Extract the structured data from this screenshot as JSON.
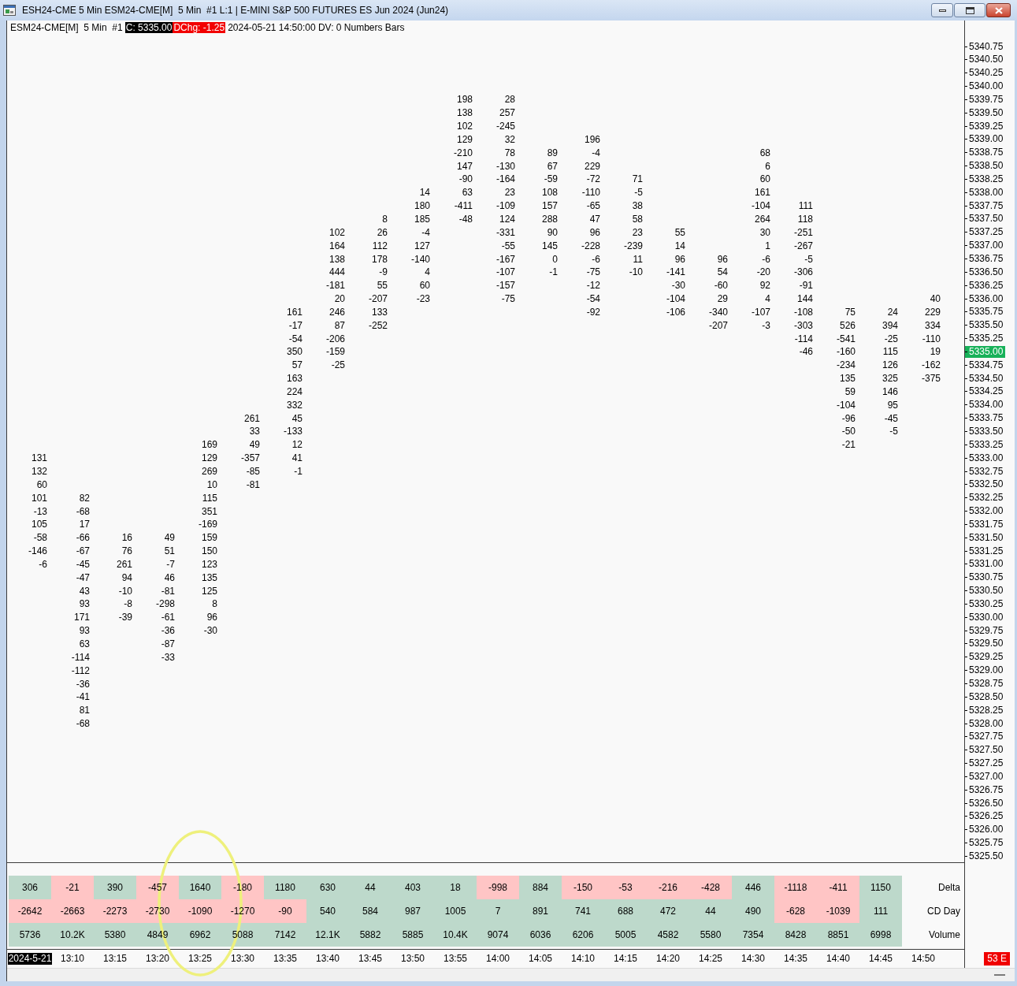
{
  "window": {
    "title": "ESH24-CME 5 Min ESM24-CME[M]  5 Min  #1 L:1 | E-MINI S&P 500 FUTURES ES Jun 2024 (Jun24)"
  },
  "header": [
    {
      "kind": "plain",
      "text": "ESM24-CME[M]  5 Min  #1"
    },
    {
      "kind": "close",
      "text": "C: 5335.00"
    },
    {
      "kind": "change",
      "text": "DChg: -1.25"
    },
    {
      "kind": "plain",
      "text": "2024-05-21 14:50:00 DV: 0 Numbers Bars"
    }
  ],
  "price_axis": [
    {
      "text": "5340.75",
      "selected": false
    },
    {
      "text": "5340.50",
      "selected": false
    },
    {
      "text": "5340.25",
      "selected": false
    },
    {
      "text": "5340.00",
      "selected": false
    },
    {
      "text": "5339.75",
      "selected": false
    },
    {
      "text": "5339.50",
      "selected": false
    },
    {
      "text": "5339.25",
      "selected": false
    },
    {
      "text": "5339.00",
      "selected": false
    },
    {
      "text": "5338.75",
      "selected": false
    },
    {
      "text": "5338.50",
      "selected": false
    },
    {
      "text": "5338.25",
      "selected": false
    },
    {
      "text": "5338.00",
      "selected": false
    },
    {
      "text": "5337.75",
      "selected": false
    },
    {
      "text": "5337.50",
      "selected": false
    },
    {
      "text": "5337.25",
      "selected": false
    },
    {
      "text": "5337.00",
      "selected": false
    },
    {
      "text": "5336.75",
      "selected": false
    },
    {
      "text": "5336.50",
      "selected": false
    },
    {
      "text": "5336.25",
      "selected": false
    },
    {
      "text": "5336.00",
      "selected": false
    },
    {
      "text": "5335.75",
      "selected": false
    },
    {
      "text": "5335.50",
      "selected": false
    },
    {
      "text": "5335.25",
      "selected": false
    },
    {
      "text": "5335.00",
      "selected": true
    },
    {
      "text": "5334.75",
      "selected": false
    },
    {
      "text": "5334.50",
      "selected": false
    },
    {
      "text": "5334.25",
      "selected": false
    },
    {
      "text": "5334.00",
      "selected": false
    },
    {
      "text": "5333.75",
      "selected": false
    },
    {
      "text": "5333.50",
      "selected": false
    },
    {
      "text": "5333.25",
      "selected": false
    },
    {
      "text": "5333.00",
      "selected": false
    },
    {
      "text": "5332.75",
      "selected": false
    },
    {
      "text": "5332.50",
      "selected": false
    },
    {
      "text": "5332.25",
      "selected": false
    },
    {
      "text": "5332.00",
      "selected": false
    },
    {
      "text": "5331.75",
      "selected": false
    },
    {
      "text": "5331.50",
      "selected": false
    },
    {
      "text": "5331.25",
      "selected": false
    },
    {
      "text": "5331.00",
      "selected": false
    },
    {
      "text": "5330.75",
      "selected": false
    },
    {
      "text": "5330.50",
      "selected": false
    },
    {
      "text": "5330.25",
      "selected": false
    },
    {
      "text": "5330.00",
      "selected": false
    },
    {
      "text": "5329.75",
      "selected": false
    },
    {
      "text": "5329.50",
      "selected": false
    },
    {
      "text": "5329.25",
      "selected": false
    },
    {
      "text": "5329.00",
      "selected": false
    },
    {
      "text": "5328.75",
      "selected": false
    },
    {
      "text": "5328.50",
      "selected": false
    },
    {
      "text": "5328.25",
      "selected": false
    },
    {
      "text": "5328.00",
      "selected": false
    },
    {
      "text": "5327.75",
      "selected": false
    },
    {
      "text": "5327.50",
      "selected": false
    },
    {
      "text": "5327.25",
      "selected": false
    },
    {
      "text": "5327.00",
      "selected": false
    },
    {
      "text": "5326.75",
      "selected": false
    },
    {
      "text": "5326.50",
      "selected": false
    },
    {
      "text": "5326.25",
      "selected": false
    },
    {
      "text": "5326.00",
      "selected": false
    },
    {
      "text": "5325.75",
      "selected": false
    },
    {
      "text": "5325.50",
      "selected": false
    }
  ],
  "bars": [
    {
      "cells": [
        null,
        null,
        null,
        null,
        null,
        null,
        null,
        null,
        null,
        null,
        null,
        null,
        null,
        null,
        null,
        null,
        null,
        null,
        null,
        null,
        null,
        null,
        null,
        null,
        null,
        null,
        null,
        null,
        null,
        null,
        null,
        "131",
        "132",
        "60",
        "101",
        "-13",
        "105",
        "-58",
        "-146",
        "-6"
      ]
    },
    {
      "cells": [
        null,
        null,
        null,
        null,
        null,
        null,
        null,
        null,
        null,
        null,
        null,
        null,
        null,
        null,
        null,
        null,
        null,
        null,
        null,
        null,
        null,
        null,
        null,
        null,
        null,
        null,
        null,
        null,
        null,
        null,
        null,
        null,
        null,
        null,
        "82",
        "-68",
        "17",
        "-66",
        "-67",
        "-45",
        "-47",
        "43",
        "93",
        "171",
        "93",
        "63",
        "-114",
        "-112",
        "-36",
        "-41",
        "81",
        "-68"
      ]
    },
    {
      "cells": [
        null,
        null,
        null,
        null,
        null,
        null,
        null,
        null,
        null,
        null,
        null,
        null,
        null,
        null,
        null,
        null,
        null,
        null,
        null,
        null,
        null,
        null,
        null,
        null,
        null,
        null,
        null,
        null,
        null,
        null,
        null,
        null,
        null,
        null,
        null,
        null,
        null,
        "16",
        "76",
        "261",
        "94",
        "-10",
        "-8",
        "-39"
      ]
    },
    {
      "cells": [
        null,
        null,
        null,
        null,
        null,
        null,
        null,
        null,
        null,
        null,
        null,
        null,
        null,
        null,
        null,
        null,
        null,
        null,
        null,
        null,
        null,
        null,
        null,
        null,
        null,
        null,
        null,
        null,
        null,
        null,
        null,
        null,
        null,
        null,
        null,
        null,
        null,
        "49",
        "51",
        "-7",
        "46",
        "-81",
        "-298",
        "-61",
        "-36",
        "-87",
        "-33"
      ]
    },
    {
      "cells": [
        null,
        null,
        null,
        null,
        null,
        null,
        null,
        null,
        null,
        null,
        null,
        null,
        null,
        null,
        null,
        null,
        null,
        null,
        null,
        null,
        null,
        null,
        null,
        null,
        null,
        null,
        null,
        null,
        null,
        null,
        "169",
        "129",
        "269",
        "10",
        "115",
        "351",
        "-169",
        "159",
        "150",
        "123",
        "135",
        "125",
        "8",
        "96",
        "-30"
      ]
    },
    {
      "cells": [
        null,
        null,
        null,
        null,
        null,
        null,
        null,
        null,
        null,
        null,
        null,
        null,
        null,
        null,
        null,
        null,
        null,
        null,
        null,
        null,
        null,
        null,
        null,
        null,
        null,
        null,
        null,
        null,
        "261",
        "33",
        "49",
        "-357",
        "-85",
        "-81"
      ]
    },
    {
      "cells": [
        null,
        null,
        null,
        null,
        null,
        null,
        null,
        null,
        null,
        null,
        null,
        null,
        null,
        null,
        null,
        null,
        null,
        null,
        null,
        null,
        "161",
        "-17",
        "-54",
        "350",
        "57",
        "163",
        "224",
        "332",
        "45",
        "-133",
        "12",
        "41",
        "-1"
      ]
    },
    {
      "cells": [
        null,
        null,
        null,
        null,
        null,
        null,
        null,
        null,
        null,
        null,
        null,
        null,
        null,
        null,
        "102",
        "164",
        "138",
        "444",
        "-181",
        "20",
        "246",
        "87",
        "-206",
        "-159",
        "-25"
      ]
    },
    {
      "cells": [
        null,
        null,
        null,
        null,
        null,
        null,
        null,
        null,
        null,
        null,
        null,
        null,
        null,
        "8",
        "26",
        "112",
        "178",
        "-9",
        "55",
        "-207",
        "133",
        "-252"
      ]
    },
    {
      "cells": [
        null,
        null,
        null,
        null,
        null,
        null,
        null,
        null,
        null,
        null,
        null,
        "14",
        "180",
        "185",
        "-4",
        "127",
        "-140",
        "4",
        "60",
        "-23"
      ]
    },
    {
      "cells": [
        null,
        null,
        null,
        null,
        "198",
        "138",
        "102",
        "129",
        "-210",
        "147",
        "-90",
        "63",
        "-411",
        "-48"
      ]
    },
    {
      "cells": [
        null,
        null,
        null,
        null,
        "28",
        "257",
        "-245",
        "32",
        "78",
        "-130",
        "-164",
        "23",
        "-109",
        "124",
        "-331",
        "-55",
        "-167",
        "-107",
        "-157",
        "-75"
      ]
    },
    {
      "cells": [
        null,
        null,
        null,
        null,
        null,
        null,
        null,
        null,
        "89",
        "67",
        "-59",
        "108",
        "157",
        "288",
        "90",
        "145",
        "0",
        "-1"
      ]
    },
    {
      "cells": [
        null,
        null,
        null,
        null,
        null,
        null,
        null,
        "196",
        "-4",
        "229",
        "-72",
        "-110",
        "-65",
        "47",
        "96",
        "-228",
        "-6",
        "-75",
        "-12",
        "-54",
        "-92"
      ]
    },
    {
      "cells": [
        null,
        null,
        null,
        null,
        null,
        null,
        null,
        null,
        null,
        null,
        "71",
        "-5",
        "38",
        "58",
        "23",
        "-239",
        "11",
        "-10"
      ]
    },
    {
      "cells": [
        null,
        null,
        null,
        null,
        null,
        null,
        null,
        null,
        null,
        null,
        null,
        null,
        null,
        null,
        "55",
        "14",
        "96",
        "-141",
        "-30",
        "-104",
        "-106"
      ]
    },
    {
      "cells": [
        null,
        null,
        null,
        null,
        null,
        null,
        null,
        null,
        null,
        null,
        null,
        null,
        null,
        null,
        null,
        null,
        "96",
        "54",
        "-60",
        "29",
        "-340",
        "-207"
      ]
    },
    {
      "cells": [
        null,
        null,
        null,
        null,
        null,
        null,
        null,
        null,
        "68",
        "6",
        "60",
        "161",
        "-104",
        "264",
        "30",
        "1",
        "-6",
        "-20",
        "92",
        "4",
        "-107",
        "-3"
      ]
    },
    {
      "cells": [
        null,
        null,
        null,
        null,
        null,
        null,
        null,
        null,
        null,
        null,
        null,
        null,
        "111",
        "118",
        "-251",
        "-267",
        "-5",
        "-306",
        "-91",
        "144",
        "-108",
        "-303",
        "-114",
        "-46"
      ]
    },
    {
      "cells": [
        null,
        null,
        null,
        null,
        null,
        null,
        null,
        null,
        null,
        null,
        null,
        null,
        null,
        null,
        null,
        null,
        null,
        null,
        null,
        null,
        "75",
        "526",
        "-541",
        "-160",
        "-234",
        "135",
        "59",
        "-104",
        "-96",
        "-50",
        "-21"
      ]
    },
    {
      "cells": [
        null,
        null,
        null,
        null,
        null,
        null,
        null,
        null,
        null,
        null,
        null,
        null,
        null,
        null,
        null,
        null,
        null,
        null,
        null,
        null,
        "24",
        "394",
        "-25",
        "115",
        "126",
        "325",
        "146",
        "95",
        "-45",
        "-5"
      ]
    },
    {
      "cells": [
        null,
        null,
        null,
        null,
        null,
        null,
        null,
        null,
        null,
        null,
        null,
        null,
        null,
        null,
        null,
        null,
        null,
        null,
        null,
        "40",
        "229",
        "334",
        "-110",
        "19",
        "-162",
        "-375"
      ]
    }
  ],
  "stats": [
    {
      "label": "Delta",
      "cells": [
        {
          "text": "306",
          "color": "#bdd9cb"
        },
        {
          "text": "-21",
          "color": "#ffc5c5"
        },
        {
          "text": "390",
          "color": "#bdd9cb"
        },
        {
          "text": "-457",
          "color": "#ffc5c5"
        },
        {
          "text": "1640",
          "color": "#bdd9cb"
        },
        {
          "text": "-180",
          "color": "#ffc5c5"
        },
        {
          "text": "1180",
          "color": "#bdd9cb"
        },
        {
          "text": "630",
          "color": "#bdd9cb"
        },
        {
          "text": "44",
          "color": "#bdd9cb"
        },
        {
          "text": "403",
          "color": "#bdd9cb"
        },
        {
          "text": "18",
          "color": "#bdd9cb"
        },
        {
          "text": "-998",
          "color": "#ffc5c5"
        },
        {
          "text": "884",
          "color": "#bdd9cb"
        },
        {
          "text": "-150",
          "color": "#ffc5c5"
        },
        {
          "text": "-53",
          "color": "#ffc5c5"
        },
        {
          "text": "-216",
          "color": "#ffc5c5"
        },
        {
          "text": "-428",
          "color": "#ffc5c5"
        },
        {
          "text": "446",
          "color": "#bdd9cb"
        },
        {
          "text": "-1118",
          "color": "#ffc5c5"
        },
        {
          "text": "-411",
          "color": "#ffc5c5"
        },
        {
          "text": "1150",
          "color": "#bdd9cb"
        }
      ]
    },
    {
      "label": "CD Day",
      "cells": [
        {
          "text": "-2642",
          "color": "#ffc5c5"
        },
        {
          "text": "-2663",
          "color": "#ffc5c5"
        },
        {
          "text": "-2273",
          "color": "#ffc5c5"
        },
        {
          "text": "-2730",
          "color": "#ffc5c5"
        },
        {
          "text": "-1090",
          "color": "#ffc5c5"
        },
        {
          "text": "-1270",
          "color": "#ffc5c5"
        },
        {
          "text": "-90",
          "color": "#ffc5c5"
        },
        {
          "text": "540",
          "color": "#bdd9cb"
        },
        {
          "text": "584",
          "color": "#bdd9cb"
        },
        {
          "text": "987",
          "color": "#bdd9cb"
        },
        {
          "text": "1005",
          "color": "#bdd9cb"
        },
        {
          "text": "7",
          "color": "#bdd9cb"
        },
        {
          "text": "891",
          "color": "#bdd9cb"
        },
        {
          "text": "741",
          "color": "#bdd9cb"
        },
        {
          "text": "688",
          "color": "#bdd9cb"
        },
        {
          "text": "472",
          "color": "#bdd9cb"
        },
        {
          "text": "44",
          "color": "#bdd9cb"
        },
        {
          "text": "490",
          "color": "#bdd9cb"
        },
        {
          "text": "-628",
          "color": "#ffc5c5"
        },
        {
          "text": "-1039",
          "color": "#ffc5c5"
        },
        {
          "text": "111",
          "color": "#bdd9cb"
        }
      ]
    },
    {
      "label": "Volume",
      "cells": [
        {
          "text": "5736",
          "color": "#bdd9cb"
        },
        {
          "text": "10.2K",
          "color": "#bdd9cb"
        },
        {
          "text": "5380",
          "color": "#bdd9cb"
        },
        {
          "text": "4849",
          "color": "#bdd9cb"
        },
        {
          "text": "6962",
          "color": "#bdd9cb"
        },
        {
          "text": "5088",
          "color": "#bdd9cb"
        },
        {
          "text": "7142",
          "color": "#bdd9cb"
        },
        {
          "text": "12.1K",
          "color": "#bdd9cb"
        },
        {
          "text": "5882",
          "color": "#bdd9cb"
        },
        {
          "text": "5885",
          "color": "#bdd9cb"
        },
        {
          "text": "10.4K",
          "color": "#bdd9cb"
        },
        {
          "text": "9074",
          "color": "#bdd9cb"
        },
        {
          "text": "6036",
          "color": "#bdd9cb"
        },
        {
          "text": "6206",
          "color": "#bdd9cb"
        },
        {
          "text": "5005",
          "color": "#bdd9cb"
        },
        {
          "text": "4582",
          "color": "#bdd9cb"
        },
        {
          "text": "5580",
          "color": "#bdd9cb"
        },
        {
          "text": "7354",
          "color": "#bdd9cb"
        },
        {
          "text": "8428",
          "color": "#bdd9cb"
        },
        {
          "text": "8851",
          "color": "#bdd9cb"
        },
        {
          "text": "6998",
          "color": "#bdd9cb"
        }
      ]
    }
  ],
  "time_axis": [
    {
      "kind": "date",
      "text": "2024-5-21",
      "circled": false
    },
    {
      "kind": "time",
      "text": "13:10",
      "circled": false
    },
    {
      "kind": "time",
      "text": "13:15",
      "circled": false
    },
    {
      "kind": "time",
      "text": "13:20",
      "circled": false
    },
    {
      "kind": "time",
      "text": "13:25",
      "circled": true
    },
    {
      "kind": "time",
      "text": "13:30",
      "circled": false
    },
    {
      "kind": "time",
      "text": "13:35",
      "circled": false
    },
    {
      "kind": "time",
      "text": "13:40",
      "circled": false
    },
    {
      "kind": "time",
      "text": "13:45",
      "circled": false
    },
    {
      "kind": "time",
      "text": "13:50",
      "circled": false
    },
    {
      "kind": "time",
      "text": "13:55",
      "circled": false
    },
    {
      "kind": "time",
      "text": "14:00",
      "circled": false
    },
    {
      "kind": "time",
      "text": "14:05",
      "circled": false
    },
    {
      "kind": "time",
      "text": "14:10",
      "circled": false
    },
    {
      "kind": "time",
      "text": "14:15",
      "circled": false
    },
    {
      "kind": "time",
      "text": "14:20",
      "circled": false
    },
    {
      "kind": "time",
      "text": "14:25",
      "circled": false
    },
    {
      "kind": "time",
      "text": "14:30",
      "circled": false
    },
    {
      "kind": "time",
      "text": "14:35",
      "circled": false
    },
    {
      "kind": "time",
      "text": "14:40",
      "circled": false
    },
    {
      "kind": "time",
      "text": "14:45",
      "circled": false
    },
    {
      "kind": "time",
      "text": "14:50",
      "circled": false
    }
  ],
  "status_label": "53 E"
}
